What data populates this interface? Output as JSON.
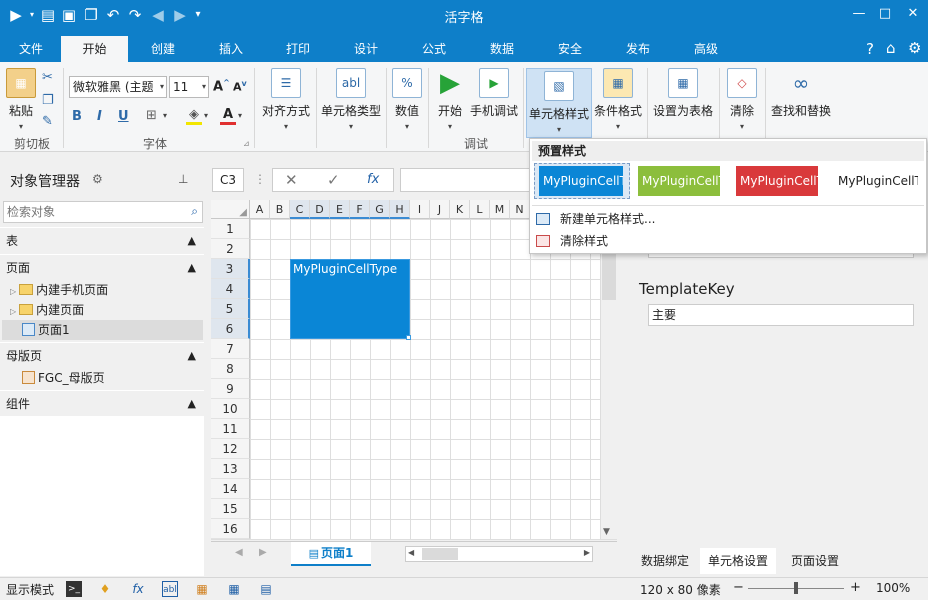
{
  "app": {
    "title": "活字格"
  },
  "quick_access": {
    "icons": [
      "run-icon",
      "run-dropdown-icon",
      "new-page-icon",
      "save-icon",
      "open-folder-icon",
      "undo-icon",
      "redo-icon",
      "back-icon",
      "forward-icon",
      "customize-icon"
    ]
  },
  "window_controls": {
    "help": "?",
    "minimize": "—",
    "maximize": "□",
    "close": "✕"
  },
  "ribbon_tabs": [
    "文件",
    "开始",
    "创建",
    "插入",
    "打印",
    "设计",
    "公式",
    "数据",
    "安全",
    "发布",
    "高级"
  ],
  "active_tab": "开始",
  "ribbon": {
    "clipboard": {
      "paste": "粘贴",
      "group": "剪切板"
    },
    "font": {
      "family": "微软雅黑 (主题",
      "size": "11",
      "bold": "B",
      "italic": "I",
      "underline": "U",
      "grow": "A",
      "shrink": "A",
      "font_color_accent": "#e03030",
      "fill_color_accent": "#f2e600",
      "group": "字体"
    },
    "align": {
      "label": "对齐方式"
    },
    "cell_type": {
      "label": "单元格类型"
    },
    "number": {
      "label": "数值",
      "icon_text": "%"
    },
    "debug": {
      "start": "开始",
      "mobile": "手机调试",
      "group": "调试"
    },
    "cell_style": {
      "label": "单元格样式"
    },
    "cond_format": {
      "label": "条件格式"
    },
    "as_table": {
      "label": "设置为表格"
    },
    "clear": {
      "label": "清除"
    },
    "find": {
      "label": "查找和替换"
    }
  },
  "cell_style_dropdown": {
    "header": "预置样式",
    "styles": [
      {
        "label": "MyPluginCellT",
        "bg": "#0a86d6",
        "fg": "#ffffff"
      },
      {
        "label": "MyPluginCellT",
        "bg": "#8cbe3c",
        "fg": "#ffffff"
      },
      {
        "label": "MyPluginCellT",
        "bg": "#d9393b",
        "fg": "#ffffff"
      },
      {
        "label": "MyPluginCellT",
        "bg": "#ffffff",
        "fg": "#222222"
      }
    ],
    "new_style": "新建单元格样式...",
    "clear_style": "清除样式"
  },
  "object_manager": {
    "title": "对象管理器",
    "search_placeholder": "检索对象",
    "sections": [
      {
        "label": "表"
      },
      {
        "label": "页面",
        "items": [
          "内建手机页面",
          "内建页面",
          "页面1"
        ]
      },
      {
        "label": "母版页",
        "items": [
          "FGC_母版页"
        ]
      },
      {
        "label": "组件"
      }
    ]
  },
  "formula_bar": {
    "cell_ref": "C3",
    "cancel": "✕",
    "confirm": "✓",
    "fx": "fx",
    "value": ""
  },
  "sheet": {
    "columns": [
      "A",
      "B",
      "C",
      "D",
      "E",
      "F",
      "G",
      "H",
      "I",
      "J",
      "K",
      "L",
      "M",
      "N"
    ],
    "selected_columns": [
      "C",
      "D",
      "E",
      "F",
      "G",
      "H"
    ],
    "rows": [
      "1",
      "2",
      "3",
      "4",
      "5",
      "6",
      "7",
      "8",
      "9",
      "10",
      "11",
      "12",
      "13",
      "14",
      "15",
      "16"
    ],
    "selected_rows": [
      "3",
      "4",
      "5",
      "6"
    ],
    "merged_cell_text": "MyPluginCellType",
    "merged_cell_color": "#0a86d6",
    "sheet_tab": "页面1"
  },
  "properties": {
    "template_key_label": "TemplateKey",
    "template_key_value": "主要",
    "tabs": [
      "数据绑定",
      "单元格设置",
      "页面设置"
    ],
    "active_tab": "单元格设置"
  },
  "status": {
    "mode": "显示模式",
    "size": "120 x 80 像素",
    "zoom": "100%",
    "zoom_level": 1.0
  }
}
